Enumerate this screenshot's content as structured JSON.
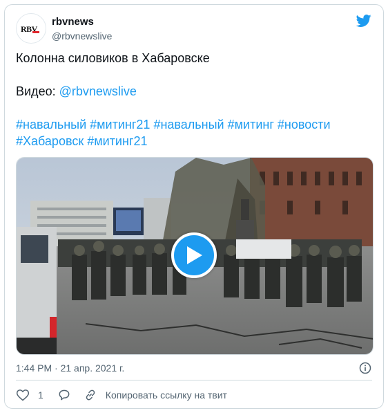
{
  "tweet": {
    "display_name": "rbvnews",
    "handle": "@rbvnewslive",
    "avatar_text": "RBV",
    "text_line1": "Колонна силовиков в Хабаровске",
    "video_label": "Видео: ",
    "video_link": "@rbvnewslive",
    "hashtags": [
      "#навальный",
      "#митинг21",
      "#навальный",
      "#митинг",
      "#новости",
      "#Хабаровск",
      "#митинг21"
    ],
    "timestamp": "1:44 PM · 21 апр. 2021 г.",
    "like_count": "1",
    "copy_link_label": "Копировать ссылку на твит"
  },
  "colors": {
    "accent": "#1d9bf0",
    "text": "#0f1419",
    "muted": "#536471",
    "border": "#cfd9de"
  },
  "icons": {
    "bird": "twitter-bird-icon",
    "play": "play-icon",
    "info": "info-icon",
    "like": "heart-icon",
    "reply": "reply-bubble-icon",
    "copy": "link-icon"
  }
}
